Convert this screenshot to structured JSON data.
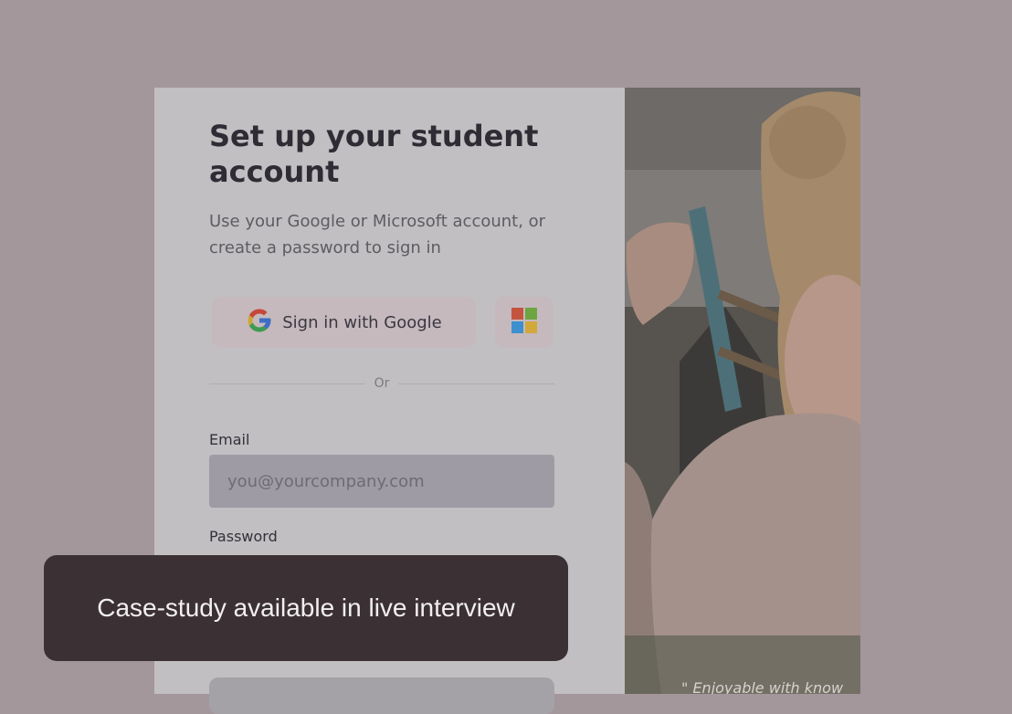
{
  "signup": {
    "title": "Set up your student account",
    "subtitle": "Use your Google or Microsoft account, or create a password to sign in",
    "google_button_label": "Sign in with Google",
    "divider_text": "Or",
    "email_label": "Email",
    "email_placeholder": "you@yourcompany.com",
    "password_label": "Password"
  },
  "side_panel": {
    "quote": "\" Enjoyable with know"
  },
  "toast": {
    "message": "Case-study available in live interview"
  },
  "icons": {
    "google": "google-logo-icon",
    "microsoft": "microsoft-logo-icon"
  },
  "colors": {
    "overlay": "#a3979c",
    "toast_bg": "#3b3134",
    "card_bg": "#c1bfc1"
  }
}
